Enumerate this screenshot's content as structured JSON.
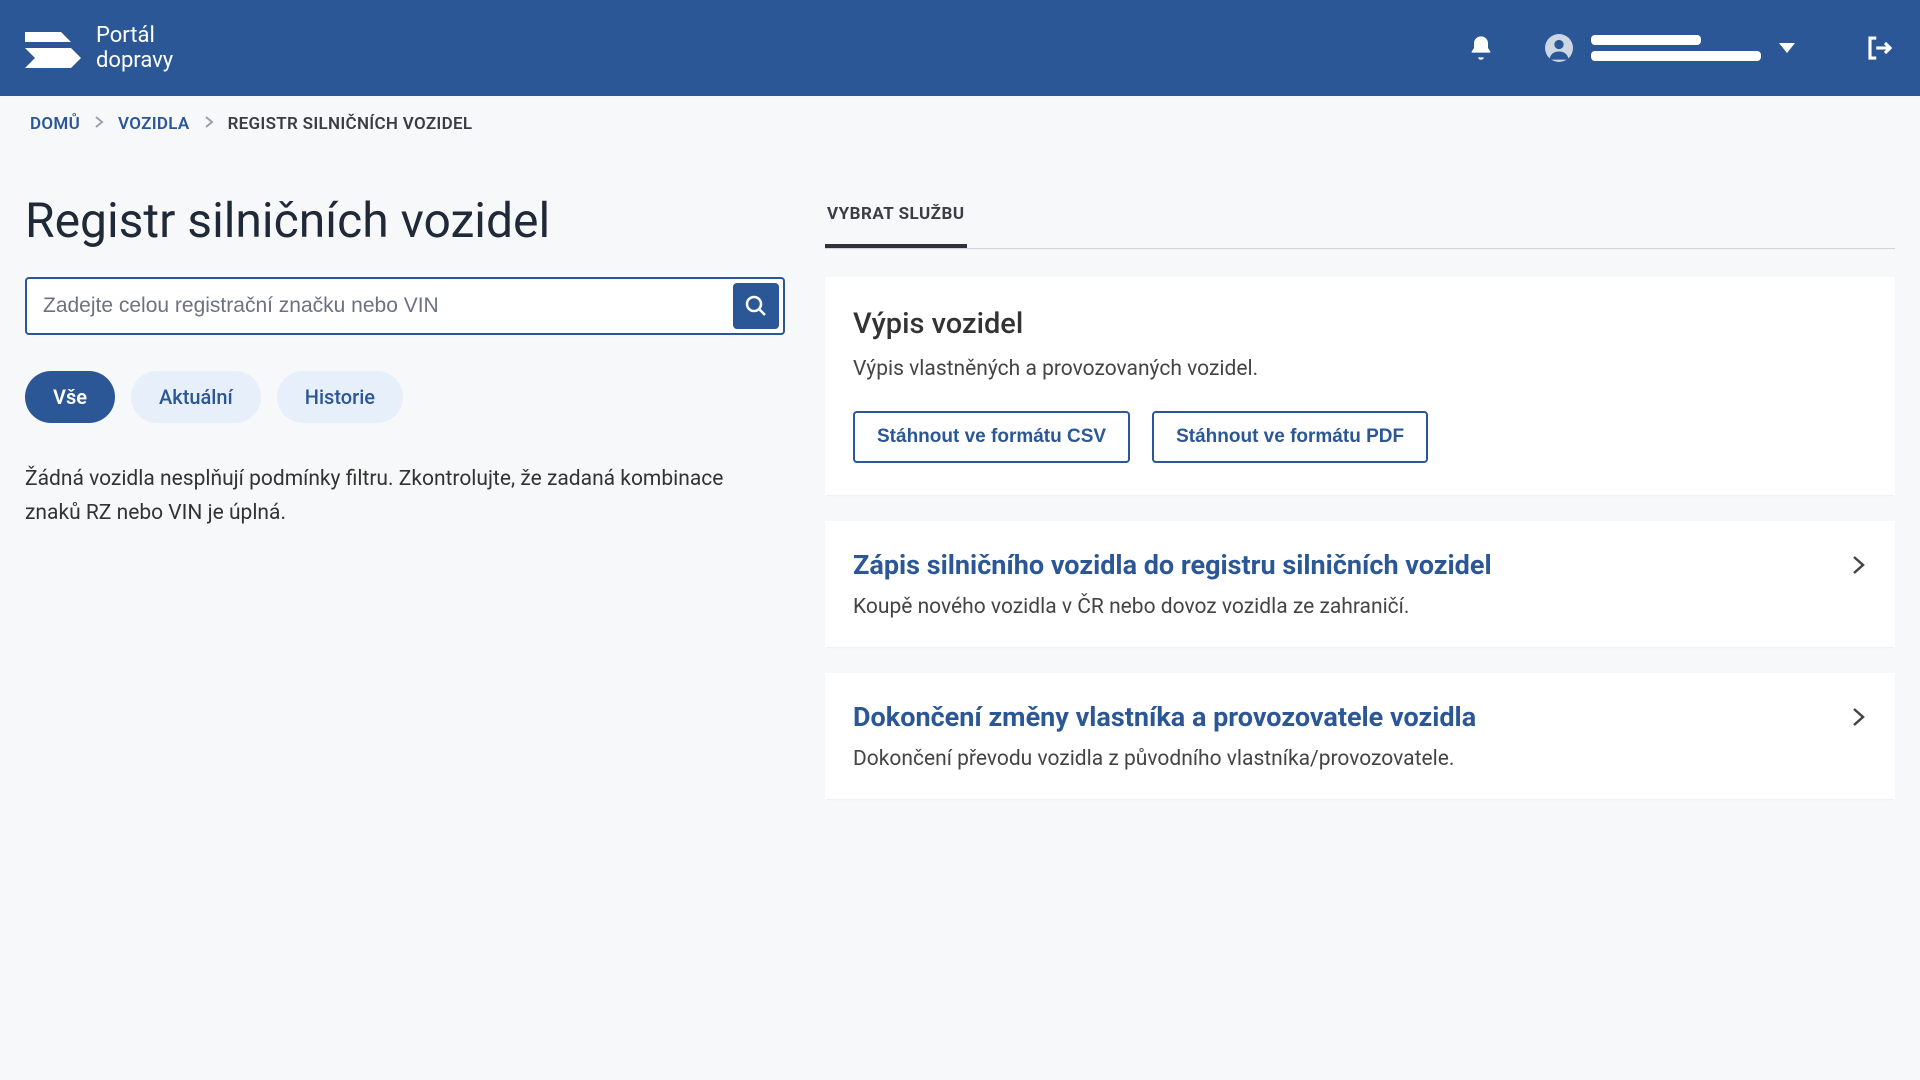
{
  "header": {
    "brand_line1": "Portál",
    "brand_line2": "dopravy"
  },
  "breadcrumb": {
    "items": [
      {
        "label": "DOMŮ",
        "link": true
      },
      {
        "label": "VOZIDLA",
        "link": true
      },
      {
        "label": "REGISTR SILNIČNÍCH VOZIDEL",
        "link": false
      }
    ]
  },
  "page": {
    "title": "Registr silničních vozidel",
    "search_placeholder": "Zadejte celou registrační značku nebo VIN",
    "filters": {
      "all": "Vše",
      "current": "Aktuální",
      "history": "Historie"
    },
    "empty_message": "Žádná vozidla nesplňují podmínky filtru. Zkontrolujte, že zadaná kombinace znaků RZ nebo VIN je úplná."
  },
  "right": {
    "tab": "VYBRAT SLUŽBU",
    "export_card": {
      "title": "Výpis vozidel",
      "subtitle": "Výpis vlastněných a provozovaných vozidel.",
      "btn_csv": "Stáhnout ve formátu CSV",
      "btn_pdf": "Stáhnout ve formátu PDF"
    },
    "services": [
      {
        "title": "Zápis silničního vozidla do registru silničních vozidel",
        "desc": "Koupě nového vozidla v ČR nebo dovoz vozidla ze zahraničí."
      },
      {
        "title": "Dokončení změny vlastníka a provozovatele vozidla",
        "desc": "Dokončení převodu vozidla z původního vlastníka/provozovatele."
      }
    ]
  }
}
